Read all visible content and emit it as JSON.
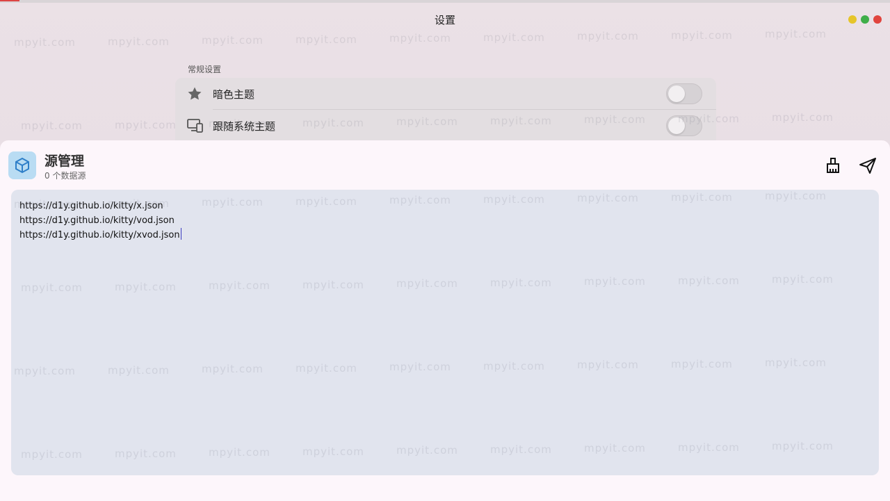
{
  "window": {
    "title": "设置",
    "controls": [
      "minimize",
      "maximize",
      "close"
    ]
  },
  "settings": {
    "section_label": "常规设置",
    "items": [
      {
        "label": "暗色主题",
        "icon": "star-icon",
        "enabled": false
      },
      {
        "label": "跟随系统主题",
        "icon": "monitor-icon",
        "enabled": false
      }
    ]
  },
  "source_sheet": {
    "title": "源管理",
    "subtitle": "0 个数据源",
    "icon": "cube-icon",
    "actions": {
      "clean": "broom-icon",
      "submit": "send-icon"
    },
    "editor_lines": [
      "https://d1y.github.io/kitty/x.json",
      "https://d1y.github.io/kitty/vod.json",
      "https://d1y.github.io/kitty/xvod.json"
    ]
  },
  "watermark_text": "mpyit.com",
  "colors": {
    "sheet_bg": "#fdf6fb",
    "editor_bg": "#e1e4ee",
    "accent_icon_bg": "#b9dcf3",
    "caret": "#3b3bbf"
  }
}
